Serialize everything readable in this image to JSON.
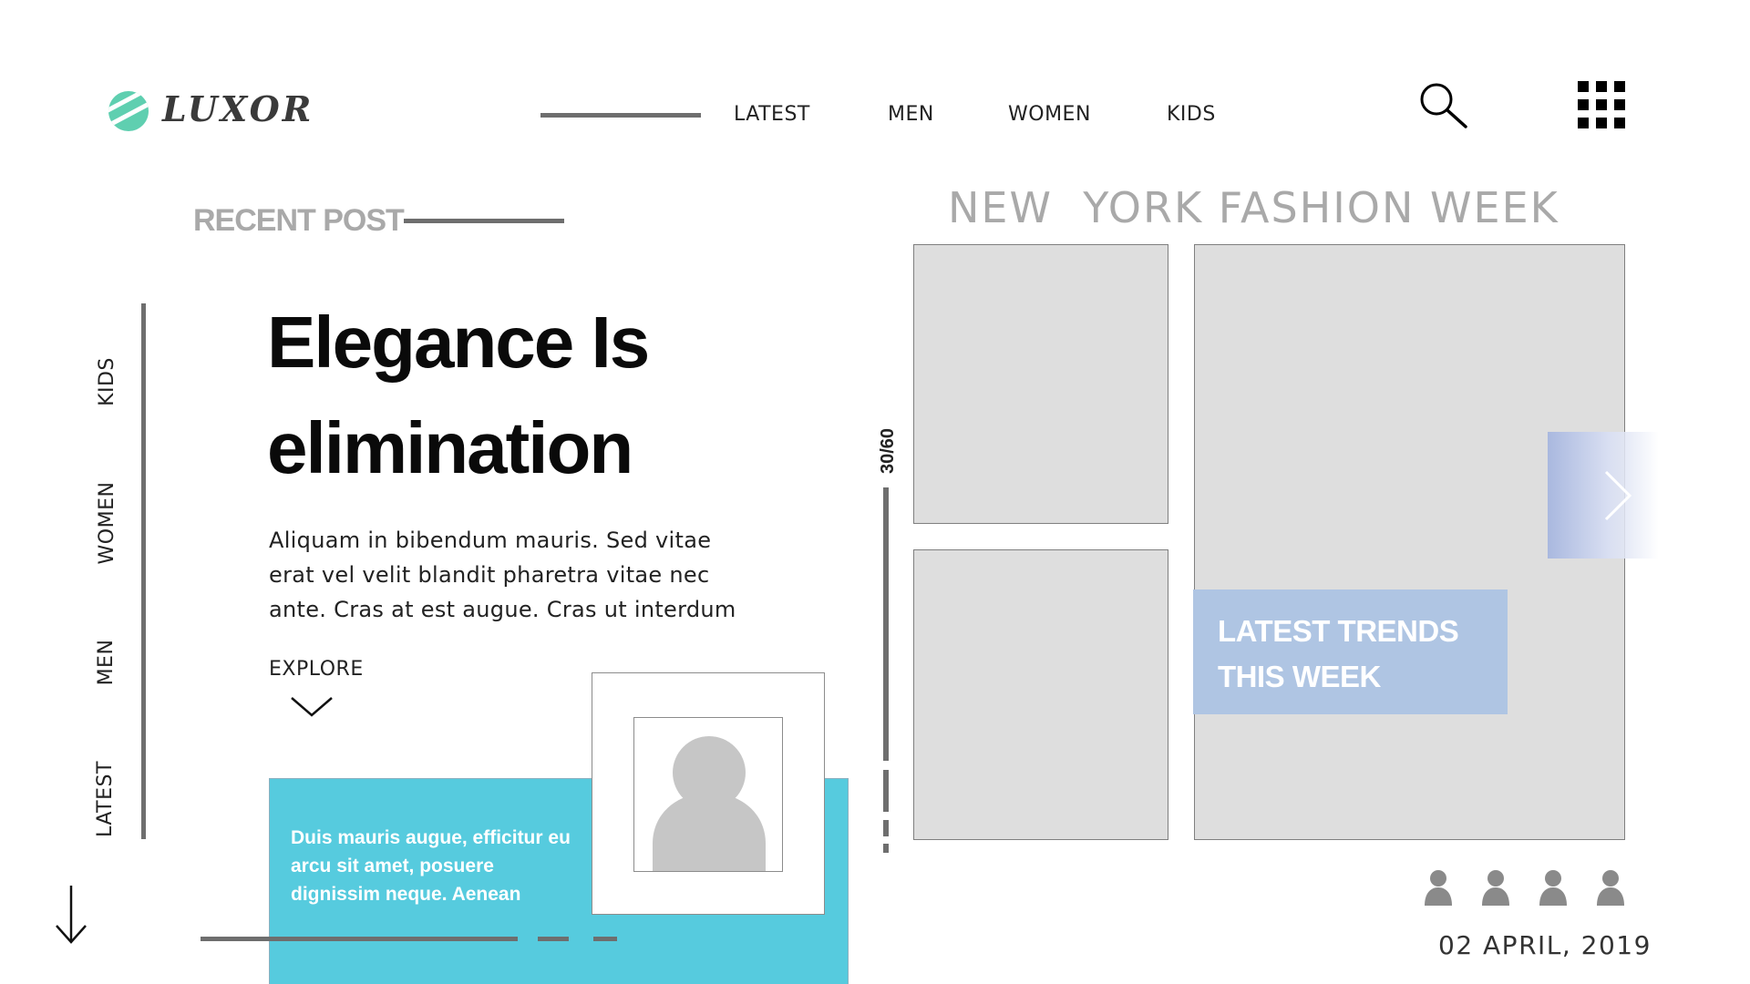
{
  "header": {
    "brand": "LUXOR",
    "nav": [
      "LATEST",
      "MEN",
      "WOMEN",
      "KIDS"
    ],
    "icons": [
      "search-icon",
      "grid-menu-icon"
    ],
    "logo_colors": [
      "#5fcfb0",
      "#3db597"
    ]
  },
  "recent_post": {
    "label": "RECENT POST",
    "title": "Elegance Is elimination",
    "body": "Aliquam in bibendum mauris. Sed vitae erat vel velit blandit pharetra vitae nec ante. Cras at est augue. Cras ut interdum",
    "explore_label": "EXPLORE"
  },
  "side_nav": [
    "KIDS",
    "WOMEN",
    "MEN",
    "LATEST"
  ],
  "card": {
    "text": "Duis mauris augue, efficitur eu arcu sit amet, posuere dignissim neque. Aenean",
    "color": "#56cbde"
  },
  "slider": {
    "counter": "30/60",
    "progress": 0.5
  },
  "gallery": {
    "title": "NEW  YORK FASHION WEEK",
    "trends_label": "LATEST TRENDS THIS WEEK",
    "trends_color": "#afc5e3"
  },
  "footer": {
    "people_count": 4,
    "date": "02 APRIL, 2019"
  }
}
